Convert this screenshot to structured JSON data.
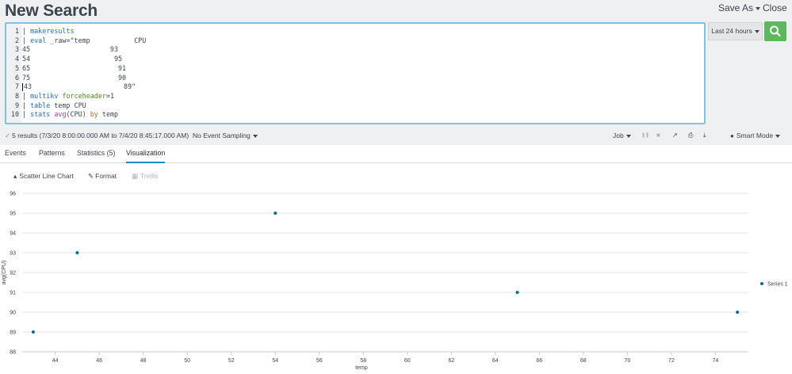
{
  "header": {
    "title": "New Search",
    "save_as_label": "Save As",
    "close_label": "Close"
  },
  "editor": {
    "lines": [
      {
        "num": "1",
        "segments": [
          {
            "t": "| ",
            "c": ""
          },
          {
            "t": "makeresults",
            "c": "kw-blue"
          }
        ]
      },
      {
        "num": "2",
        "segments": [
          {
            "t": "| ",
            "c": ""
          },
          {
            "t": "eval",
            "c": "kw-blue"
          },
          {
            "t": " _raw=\"temp           CPU",
            "c": ""
          }
        ]
      },
      {
        "num": "3",
        "segments": [
          {
            "t": "45                    93",
            "c": ""
          }
        ]
      },
      {
        "num": "4",
        "segments": [
          {
            "t": "54                     95",
            "c": ""
          }
        ]
      },
      {
        "num": "5",
        "segments": [
          {
            "t": "65                      91",
            "c": ""
          }
        ]
      },
      {
        "num": "6",
        "segments": [
          {
            "t": "75                      90",
            "c": ""
          }
        ]
      },
      {
        "num": "7",
        "segments": [
          {
            "t": "43                       89\"",
            "c": "",
            "cursor": true
          }
        ]
      },
      {
        "num": "8",
        "segments": [
          {
            "t": "| ",
            "c": ""
          },
          {
            "t": "multikv",
            "c": "kw-blue"
          },
          {
            "t": " ",
            "c": ""
          },
          {
            "t": "forceheader",
            "c": "kw-green"
          },
          {
            "t": "=1",
            "c": ""
          }
        ]
      },
      {
        "num": "9",
        "segments": [
          {
            "t": "| ",
            "c": ""
          },
          {
            "t": "table",
            "c": "kw-blue"
          },
          {
            "t": " temp CPU",
            "c": ""
          }
        ]
      },
      {
        "num": "10",
        "segments": [
          {
            "t": "| ",
            "c": ""
          },
          {
            "t": "stats",
            "c": "kw-blue"
          },
          {
            "t": " ",
            "c": ""
          },
          {
            "t": "avg",
            "c": "kw-purple"
          },
          {
            "t": "(CPU) ",
            "c": ""
          },
          {
            "t": "by",
            "c": "kw-orange"
          },
          {
            "t": " temp",
            "c": ""
          }
        ]
      }
    ]
  },
  "time_picker": {
    "label": "Last 24 hours"
  },
  "search_button": {
    "icon": "search-icon",
    "color": "#5cb85c"
  },
  "status": {
    "results_text": "5 results (7/3/20 8:00:00.000 AM to 7/4/20 8:45:17.000 AM)",
    "sampling_label": "No Event Sampling",
    "job_label": "Job",
    "smart_mode_label": "Smart Mode",
    "controls": [
      {
        "name": "pause-icon",
        "glyph": "❚❚"
      },
      {
        "name": "stop-icon",
        "glyph": "■"
      },
      {
        "name": "share-icon",
        "glyph": "↗"
      },
      {
        "name": "print-icon",
        "glyph": "⎙"
      },
      {
        "name": "export-icon",
        "glyph": "⤓"
      }
    ]
  },
  "tabs": [
    {
      "label": "Events",
      "active": false
    },
    {
      "label": "Patterns",
      "active": false
    },
    {
      "label": "Statistics (5)",
      "active": false
    },
    {
      "label": "Visualization",
      "active": true
    }
  ],
  "viz_toolbar": {
    "chart_type_label": "Scatter Line Chart",
    "format_label": "Format",
    "trellis_label": "Trellis"
  },
  "chart_data": {
    "type": "scatter",
    "x": [
      43,
      45,
      54,
      65,
      75
    ],
    "series": [
      {
        "name": "Series 1",
        "values": [
          89,
          93,
          95,
          91,
          90
        ],
        "color": "#006d9c"
      }
    ],
    "xlabel": "temp",
    "ylabel": "avg(CPU)",
    "xlim": [
      42.5,
      75.5
    ],
    "ylim": [
      88,
      96
    ],
    "x_ticks": [
      44,
      46,
      48,
      50,
      52,
      54,
      56,
      58,
      60,
      62,
      64,
      66,
      68,
      70,
      72,
      74
    ],
    "y_ticks": [
      88,
      89,
      90,
      91,
      92,
      93,
      94,
      95,
      96
    ],
    "grid": true,
    "legend": "right"
  },
  "colors": {
    "accent": "#1a87c9",
    "point": "#006d9c",
    "header_bg": "#eef0f2",
    "editor_border": "#7fc3e4"
  }
}
